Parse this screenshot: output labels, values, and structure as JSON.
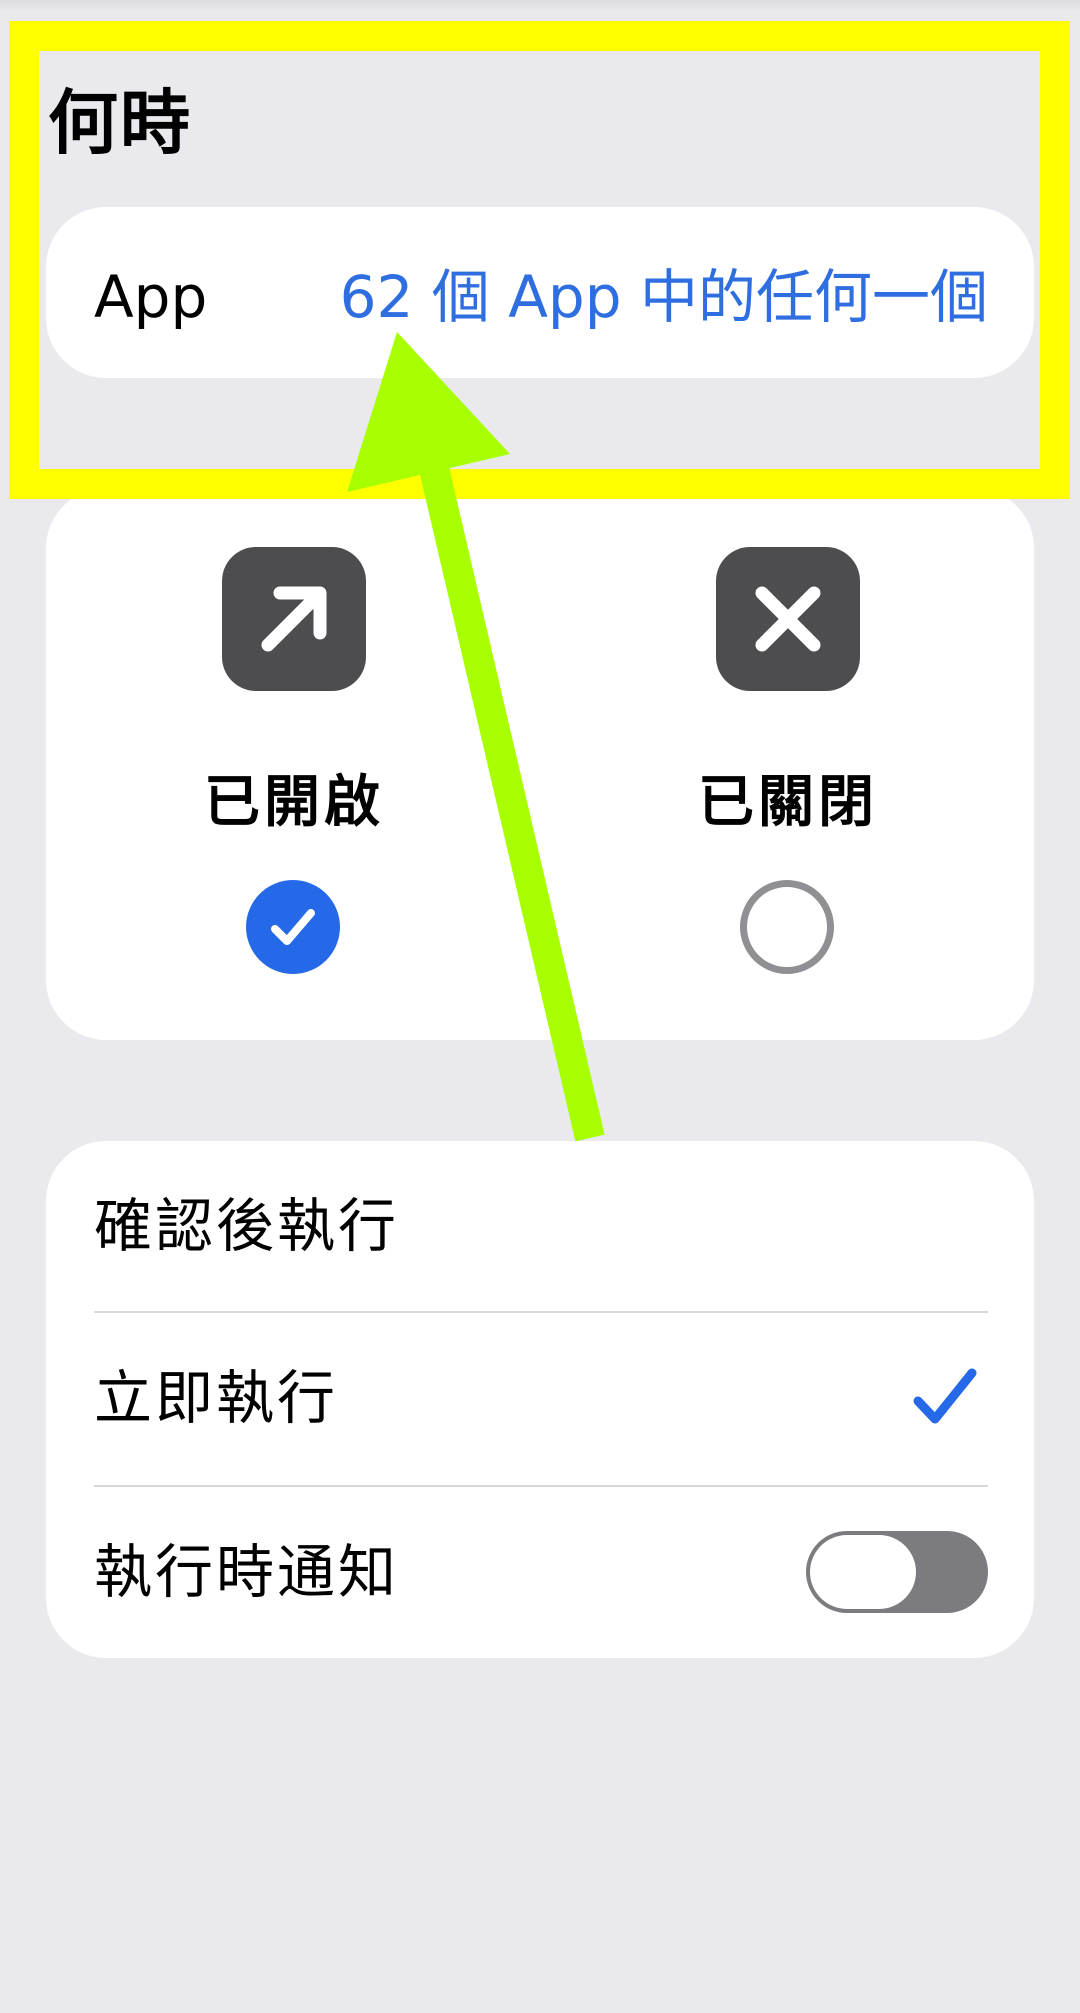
{
  "section": {
    "title": "何時"
  },
  "app_row": {
    "label": "App",
    "value": "62 個 App 中的任何一個"
  },
  "state_options": [
    {
      "label": "已開啟",
      "icon": "arrow-up-right-icon",
      "selected": true
    },
    {
      "label": "已關閉",
      "icon": "xmark-icon",
      "selected": false
    }
  ],
  "run_options": {
    "rows": [
      {
        "label": "確認後執行",
        "selected": false
      },
      {
        "label": "立即執行",
        "selected": true
      },
      {
        "label": "執行時通知",
        "toggle": false
      }
    ]
  },
  "colors": {
    "accent": "#2e6ee0",
    "highlight_box": "#ffff00",
    "annotation_arrow": "#a8ff00",
    "background": "#e9e9ee"
  }
}
